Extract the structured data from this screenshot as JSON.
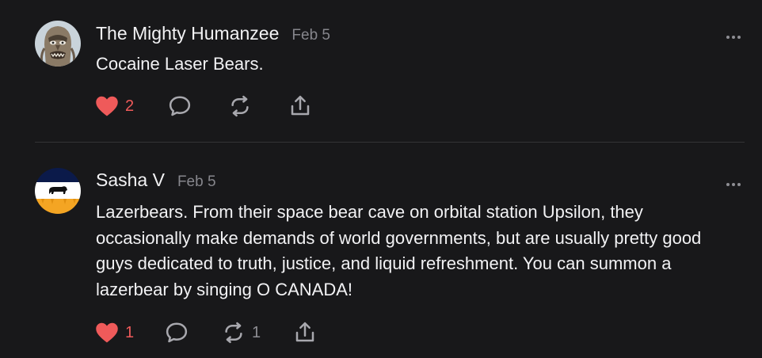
{
  "colors": {
    "background": "#18181a",
    "text": "#f2f2f4",
    "muted": "#86868c",
    "like": "#ef5a5a",
    "icon": "#a8a8ae",
    "divider": "#333336"
  },
  "posts": [
    {
      "author": "The Mighty Humanzee",
      "date": "Feb 5",
      "avatar": "bigfoot-avatar",
      "text": "Cocaine Laser Bears.",
      "likes": "2",
      "reposts": "",
      "liked": true,
      "icons": [
        "heart-icon",
        "comment-icon",
        "repost-icon",
        "share-icon",
        "more-icon"
      ]
    },
    {
      "author": "Sasha V",
      "date": "Feb 5",
      "avatar": "bison-flag-avatar",
      "text": "Lazerbears. From their space bear cave on orbital station Upsilon, they occasionally make demands of world governments, but are usually pretty good guys dedicated to truth, justice, and liquid refreshment. You can summon a lazerbear by singing O CANADA!",
      "likes": "1",
      "reposts": "1",
      "liked": true,
      "icons": [
        "heart-icon",
        "comment-icon",
        "repost-icon",
        "share-icon",
        "more-icon"
      ]
    }
  ]
}
